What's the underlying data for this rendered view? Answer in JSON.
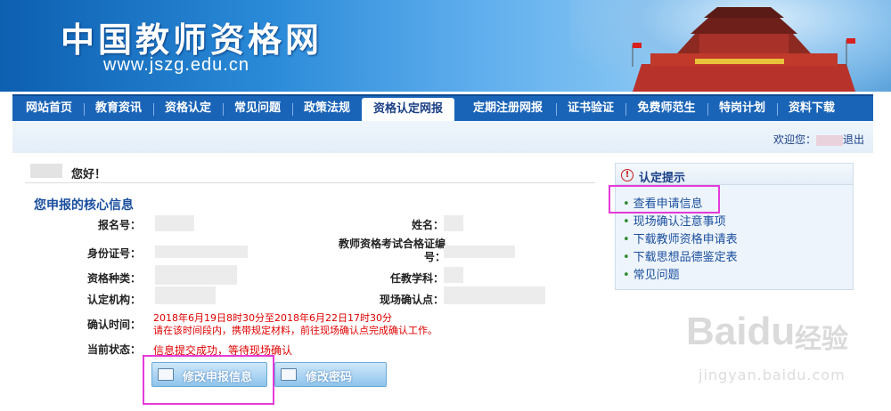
{
  "header": {
    "site_title": "中国教师资格网",
    "site_url": "www.jszg.edu.cn"
  },
  "nav": {
    "items": [
      {
        "label": "网站首页"
      },
      {
        "label": "教育资讯"
      },
      {
        "label": "资格认定"
      },
      {
        "label": "常见问题"
      },
      {
        "label": "政策法规"
      },
      {
        "label": "资格认定网报",
        "active": true
      },
      {
        "label": "定期注册网报"
      },
      {
        "label": "证书验证"
      },
      {
        "label": "免费师范生"
      },
      {
        "label": "特岗计划"
      },
      {
        "label": "资料下载"
      }
    ]
  },
  "topbar": {
    "welcome_prefix": "欢迎您：",
    "logout": "退出"
  },
  "main": {
    "greeting": "您好！",
    "section_title": "您申报的核心信息",
    "fields": {
      "report_no": "报名号：",
      "name": "姓名：",
      "id_no": "身份证号：",
      "exam_cert_no": "教师资格考试合格证编号：",
      "cert_type": "资格种类：",
      "subject": "任教学科：",
      "org": "认定机构：",
      "site": "现场确认点：",
      "confirm_time": "确认时间：",
      "status": "当前状态："
    },
    "confirm_time_value": "2018年6月19日8时30分至2018年6月22日17时30分",
    "confirm_time_note": "请在该时间段内，携带规定材料，前往现场确认点完成确认工作。",
    "status_value": "信息提交成功，等待现场确认",
    "buttons": {
      "edit": "修改申报信息",
      "password": "修改密码"
    }
  },
  "sidebar": {
    "title": "认定提示",
    "links": [
      {
        "label": "查看申请信息"
      },
      {
        "label": "现场确认注意事项"
      },
      {
        "label": "下载教师资格申请表"
      },
      {
        "label": "下载思想品德鉴定表"
      },
      {
        "label": "常见问题"
      }
    ]
  },
  "watermark": {
    "brand": "Baidu",
    "brand_cn": "经验",
    "url": "jingyan.baidu.com"
  },
  "colors": {
    "nav_bg": "#1a64b8",
    "status_red": "#e00000",
    "highlight_magenta": "#e43ad9",
    "link_blue": "#1a4f9e"
  }
}
